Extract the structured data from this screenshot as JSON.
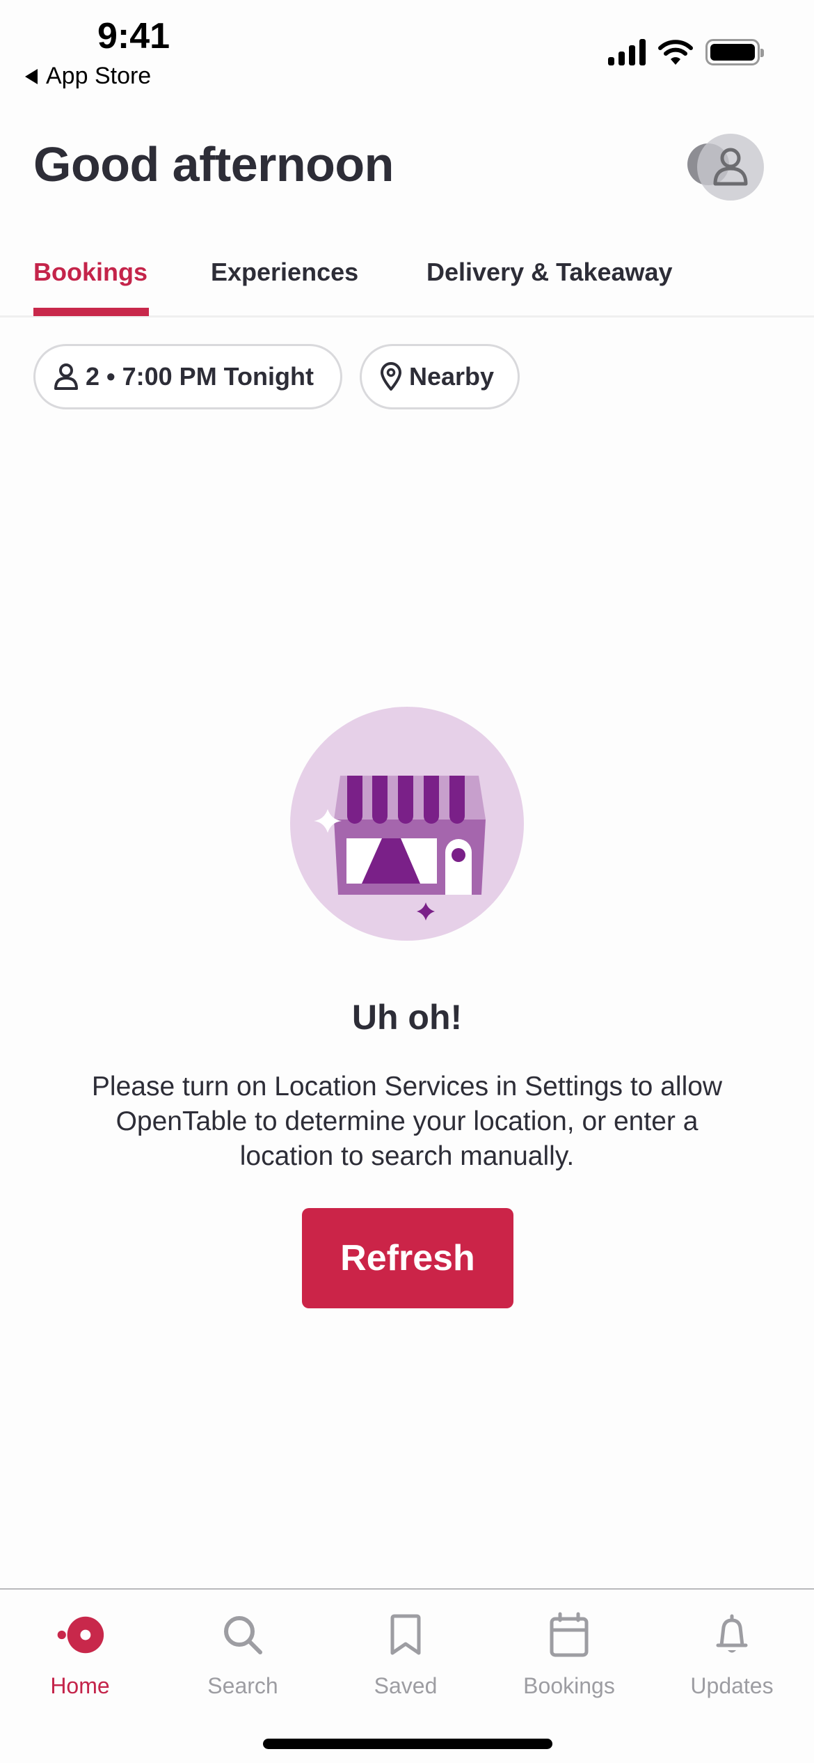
{
  "status_bar": {
    "time": "9:41",
    "back_app": "App Store",
    "icons": [
      "cellular-signal-icon",
      "wifi-icon",
      "battery-icon"
    ]
  },
  "header": {
    "greeting": "Good afternoon",
    "profile_icon": "person-icon"
  },
  "tabs": [
    {
      "label": "Bookings",
      "active": true
    },
    {
      "label": "Experiences",
      "active": false
    },
    {
      "label": "Delivery & Takeaway",
      "active": false
    }
  ],
  "filters": {
    "party_time": {
      "icon": "person-icon",
      "label": "2 • 7:00 PM Tonight"
    },
    "location": {
      "icon": "location-pin-icon",
      "label": "Nearby"
    }
  },
  "empty_state": {
    "illustration": "storefront-illustration",
    "title": "Uh oh!",
    "message": "Please turn on Location Services in Settings to allow OpenTable to determine your location, or enter a location to search manually.",
    "button_label": "Refresh"
  },
  "tab_bar": [
    {
      "label": "Home",
      "icon": "opentable-logo-icon",
      "active": true
    },
    {
      "label": "Search",
      "icon": "search-icon",
      "active": false
    },
    {
      "label": "Saved",
      "icon": "bookmark-icon",
      "active": false
    },
    {
      "label": "Bookings",
      "icon": "calendar-icon",
      "active": false
    },
    {
      "label": "Updates",
      "icon": "bell-icon",
      "active": false
    }
  ],
  "colors": {
    "accent": "#c8284b",
    "text_primary": "#2d2d37",
    "text_inactive": "#9d9da2",
    "illustration_bg": "#e6d0e8",
    "illustration_dark": "#7a2088",
    "illustration_mid": "#a566ad",
    "illustration_light": "#c79fcc"
  }
}
